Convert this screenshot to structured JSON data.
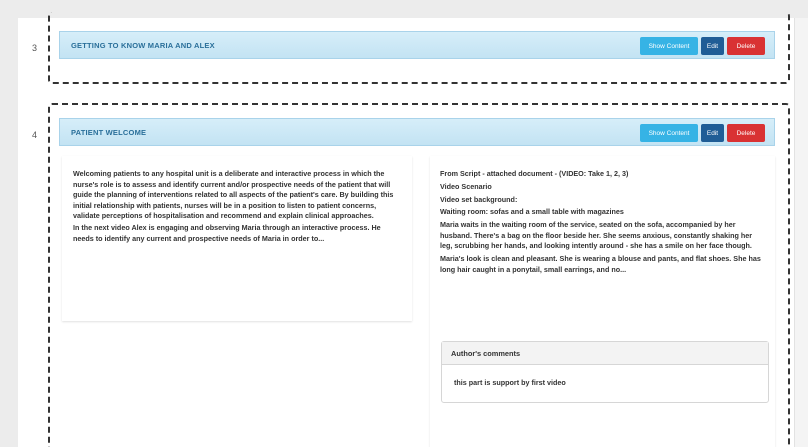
{
  "sections": [
    {
      "number": "3",
      "title": "GETTING TO KNOW MARIA AND ALEX",
      "buttons": {
        "show": "Show Content",
        "edit": "Edit",
        "delete": "Delete"
      }
    },
    {
      "number": "4",
      "title": "PATIENT WELCOME",
      "buttons": {
        "show": "Show Content",
        "edit": "Edit",
        "delete": "Delete"
      },
      "left_paragraphs": [
        "Welcoming patients to any hospital unit is a deliberate and interactive process in which the nurse's role is to assess and identify current and/or prospective needs of the patient that will guide the planning of interventions related to all aspects of the patient's care. By building this initial relationship with patients, nurses will be in a position to listen to patient concerns, validate perceptions of hospitalisation and recommend and explain clinical approaches.",
        "In the next video Alex is engaging and observing Maria through an interactive process. He needs to identify any current and prospective needs of Maria in order to..."
      ],
      "right_paragraphs": [
        "From Script - attached document - (VIDEO: Take 1, 2, 3)",
        "Video Scenario",
        "Video set background:",
        "Waiting room: sofas and a small table with magazines",
        "Maria waits in the waiting room of the service, seated on the sofa, accompanied by her husband. There's a bag on the floor beside her. She seems anxious, constantly shaking her leg, scrubbing her hands, and looking intently around - she has a smile on her face though.",
        "Maria's look is clean and pleasant. She is wearing a blouse and pants, and flat shoes. She has long hair caught in a ponytail, small earrings, and no..."
      ],
      "comments": {
        "header": "Author's comments",
        "text": "this part is support by first video"
      }
    }
  ],
  "colors": {
    "header_bg": "#c9e6f5",
    "title": "#2a6f9a",
    "show": "#36b3e5",
    "edit": "#1f5d96",
    "delete": "#d93233"
  }
}
